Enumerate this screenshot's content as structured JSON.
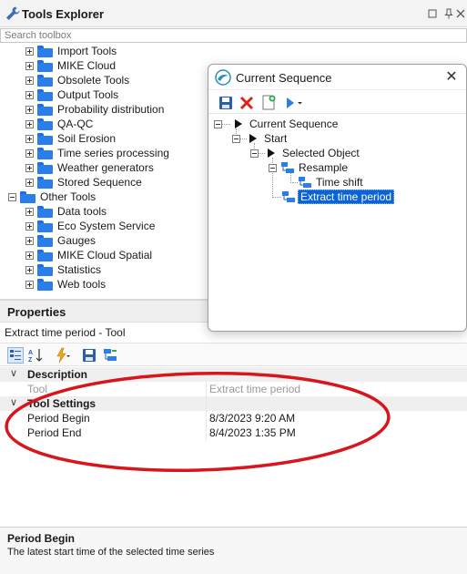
{
  "tools_explorer": {
    "title": "Tools Explorer",
    "search_placeholder": "Search toolbox",
    "tree": [
      {
        "label": "Import Tools",
        "level": 1
      },
      {
        "label": "MIKE Cloud",
        "level": 1
      },
      {
        "label": "Obsolete Tools",
        "level": 1
      },
      {
        "label": "Output Tools",
        "level": 1
      },
      {
        "label": "Probability distribution",
        "level": 1
      },
      {
        "label": "QA-QC",
        "level": 1
      },
      {
        "label": "Soil Erosion",
        "level": 1
      },
      {
        "label": "Time series processing",
        "level": 1
      },
      {
        "label": "Weather generators",
        "level": 1
      },
      {
        "label": "Stored Sequence",
        "level": 1
      },
      {
        "label": "Other Tools",
        "level": 0,
        "expanded": true
      },
      {
        "label": "Data tools",
        "level": 1
      },
      {
        "label": "Eco System Service",
        "level": 1
      },
      {
        "label": "Gauges",
        "level": 1
      },
      {
        "label": "MIKE Cloud Spatial",
        "level": 1
      },
      {
        "label": "Statistics",
        "level": 1
      },
      {
        "label": "Web tools",
        "level": 1
      }
    ]
  },
  "current_sequence": {
    "title": "Current Sequence",
    "tree": [
      {
        "label": "Current Sequence",
        "type": "root"
      },
      {
        "label": "Start",
        "type": "node"
      },
      {
        "label": "Selected Object",
        "type": "node"
      },
      {
        "label": "Resample",
        "type": "tool"
      },
      {
        "label": "Time shift",
        "type": "tool"
      },
      {
        "label": "Extract time period",
        "type": "tool",
        "selected": true
      }
    ]
  },
  "properties": {
    "title": "Properties",
    "subject": "Extract time period - Tool",
    "categories": [
      {
        "name": "Description",
        "rows": [
          {
            "name": "Tool",
            "value": "Extract time period"
          }
        ]
      },
      {
        "name": "Tool Settings",
        "rows": [
          {
            "name": "Period Begin",
            "value": "8/3/2023 9:20 AM"
          },
          {
            "name": "Period End",
            "value": "8/4/2023 1:35 PM"
          }
        ]
      }
    ],
    "description": {
      "title": "Period Begin",
      "text": "The latest start time of the selected time series"
    }
  },
  "colors": {
    "accent": "#0a64d6",
    "folder": "#2b7de9",
    "annotation": "#d8141c",
    "delete": "#d9261c"
  }
}
